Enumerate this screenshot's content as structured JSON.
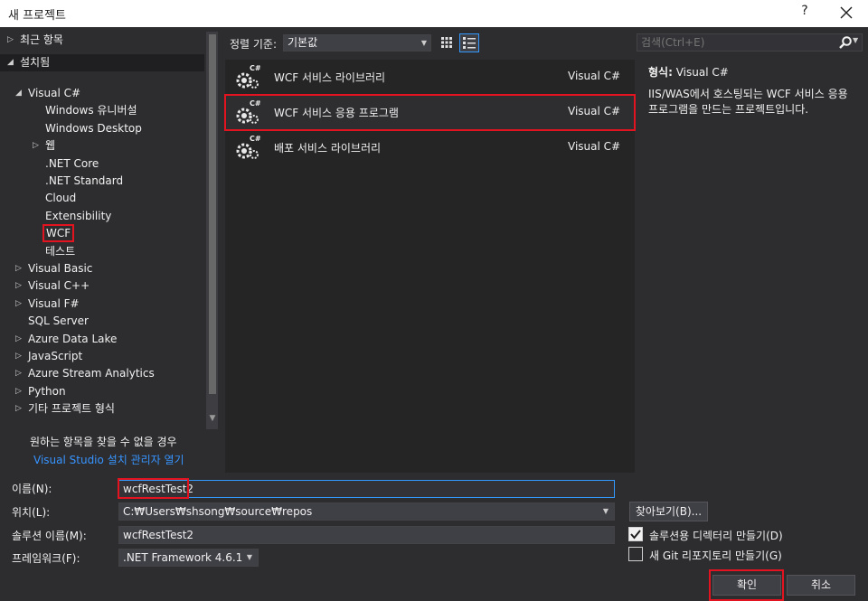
{
  "window": {
    "title": "새 프로젝트",
    "help_label": "?"
  },
  "tree": {
    "recent": "최근 항목",
    "installed": "설치됨",
    "items": [
      {
        "label": "Visual C#",
        "arrow": "◢",
        "level": 1
      },
      {
        "label": "Windows 유니버설",
        "arrow": "",
        "level": 2
      },
      {
        "label": "Windows Desktop",
        "arrow": "",
        "level": 2
      },
      {
        "label": "웹",
        "arrow": "▷",
        "level": 2
      },
      {
        "label": ".NET Core",
        "arrow": "",
        "level": 2
      },
      {
        "label": ".NET Standard",
        "arrow": "",
        "level": 2
      },
      {
        "label": "Cloud",
        "arrow": "",
        "level": 2
      },
      {
        "label": "Extensibility",
        "arrow": "",
        "level": 2
      },
      {
        "label": "WCF",
        "arrow": "",
        "level": 2
      },
      {
        "label": "테스트",
        "arrow": "",
        "level": 2
      },
      {
        "label": "Visual Basic",
        "arrow": "▷",
        "level": 1
      },
      {
        "label": "Visual C++",
        "arrow": "▷",
        "level": 1
      },
      {
        "label": "Visual F#",
        "arrow": "▷",
        "level": 1
      },
      {
        "label": "SQL Server",
        "arrow": "",
        "level": 1
      },
      {
        "label": "Azure Data Lake",
        "arrow": "▷",
        "level": 1
      },
      {
        "label": "JavaScript",
        "arrow": "▷",
        "level": 1
      },
      {
        "label": "Azure Stream Analytics",
        "arrow": "▷",
        "level": 1
      },
      {
        "label": "Python",
        "arrow": "▷",
        "level": 1
      },
      {
        "label": "기타 프로젝트 형식",
        "arrow": "▷",
        "level": 1
      }
    ],
    "not_found_text": "원하는 항목을 찾을 수 없을 경우",
    "installer_link": "Visual Studio 설치 관리자 열기"
  },
  "toolbar": {
    "sort_label": "정렬 기준:",
    "sort_value": "기본값"
  },
  "templates": [
    {
      "name": "WCF 서비스 라이브러리",
      "lang": "Visual C#",
      "selected": false
    },
    {
      "name": "WCF 서비스 응용 프로그램",
      "lang": "Visual C#",
      "selected": true
    },
    {
      "name": "배포 서비스 라이브러리",
      "lang": "Visual C#",
      "selected": false
    }
  ],
  "search": {
    "placeholder": "검색(Ctrl+E)"
  },
  "detail": {
    "type_label": "형식:",
    "type_value": "Visual C#",
    "description": "IIS/WAS에서 호스팅되는 WCF 서비스 응용 프로그램을 만드는 프로젝트입니다."
  },
  "form": {
    "name_label": "이름(N):",
    "name_value": "wcfRestTest2",
    "location_label": "위치(L):",
    "location_value": "C:₩Users₩shsong₩source₩repos",
    "solution_label": "솔루션 이름(M):",
    "solution_value": "wcfRestTest2",
    "framework_label": "프레임워크(F):",
    "framework_value": ".NET Framework 4.6.1",
    "browse_button": "찾아보기(B)...",
    "create_dir_label": "솔루션용 디렉터리 만들기(D)",
    "create_dir_checked": true,
    "git_label": "새 Git 리포지토리 만들기(G)",
    "git_checked": false,
    "ok_button": "확인",
    "cancel_button": "취소"
  },
  "colors": {
    "accent": "#3399ff",
    "highlight_red": "#e3141f",
    "link": "#3794ff"
  }
}
